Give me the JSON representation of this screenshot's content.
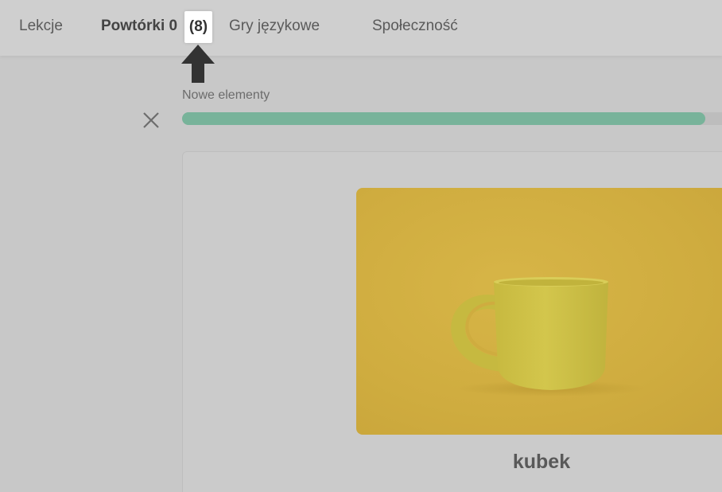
{
  "nav": {
    "lekcje": "Lekcje",
    "powtorki": "Powtórki 0",
    "powtorki_count": "(8)",
    "gry": "Gry językowe",
    "spolecznosc": "Społeczność"
  },
  "session": {
    "label": "Nowe elementy",
    "progress_fraction": 0.94
  },
  "card": {
    "image_subject": "yellow mug on yellow background",
    "word": "kubek"
  },
  "colors": {
    "progress": "#78b39a",
    "photo_bg": "#cfac3f",
    "mug": "#cfc24a"
  },
  "icons": {
    "close": "close-icon",
    "arrow": "arrow-up-icon"
  }
}
